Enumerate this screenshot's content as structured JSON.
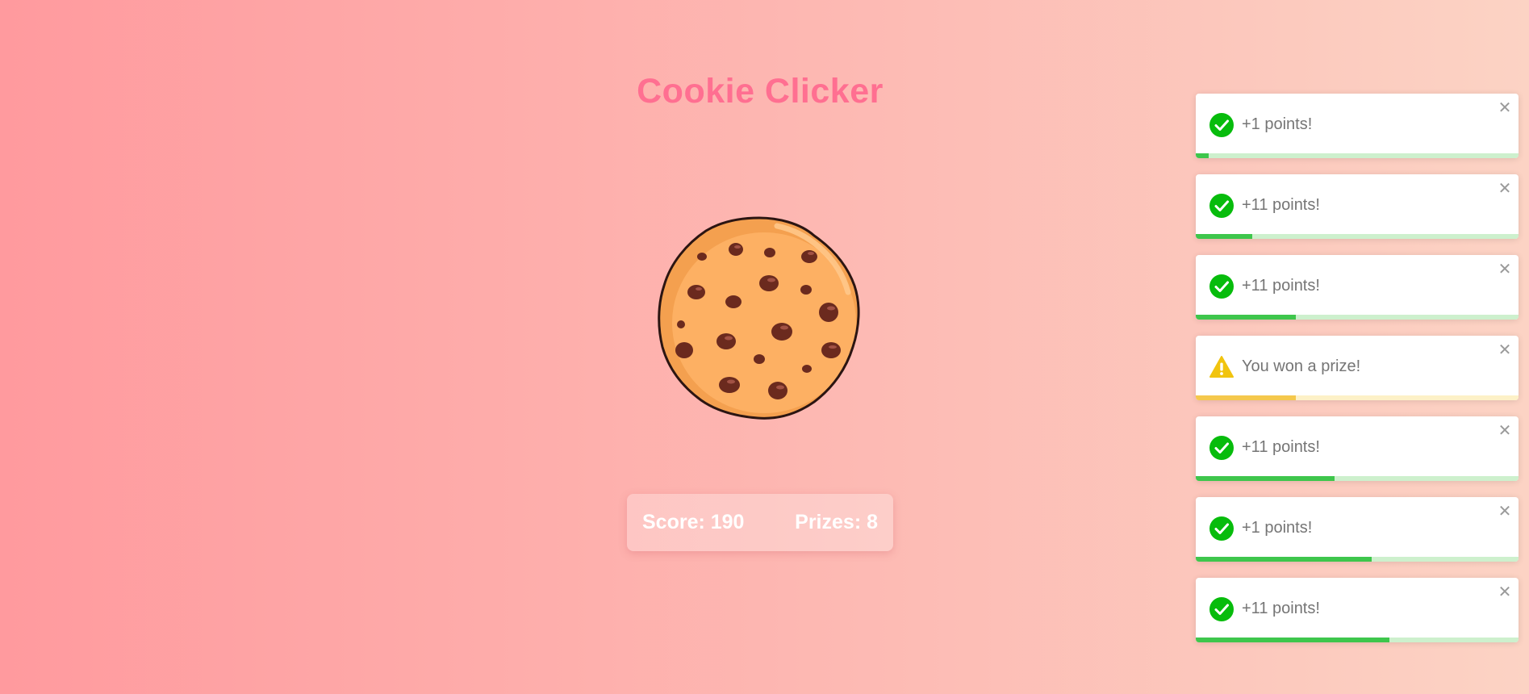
{
  "title": "Cookie Clicker",
  "cookie": {
    "icon": "cookie-icon"
  },
  "scoreboard": {
    "score_text": "Score: 190",
    "prizes_text": "Prizes: 8"
  },
  "colors": {
    "title": "#ff6f91",
    "success": "#07bc0c",
    "warning": "#f1c40f"
  },
  "toasts": [
    {
      "type": "success",
      "message": "+1 points!",
      "close_icon": "close-icon",
      "progress": 0.04
    },
    {
      "type": "success",
      "message": "+11 points!",
      "close_icon": "close-icon",
      "progress": 0.175
    },
    {
      "type": "success",
      "message": "+11 points!",
      "close_icon": "close-icon",
      "progress": 0.31
    },
    {
      "type": "warning",
      "message": "You won a prize!",
      "close_icon": "close-icon",
      "progress": 0.31
    },
    {
      "type": "success",
      "message": "+11 points!",
      "close_icon": "close-icon",
      "progress": 0.43
    },
    {
      "type": "success",
      "message": "+1 points!",
      "close_icon": "close-icon",
      "progress": 0.545
    },
    {
      "type": "success",
      "message": "+11 points!",
      "close_icon": "close-icon",
      "progress": 0.6
    }
  ]
}
